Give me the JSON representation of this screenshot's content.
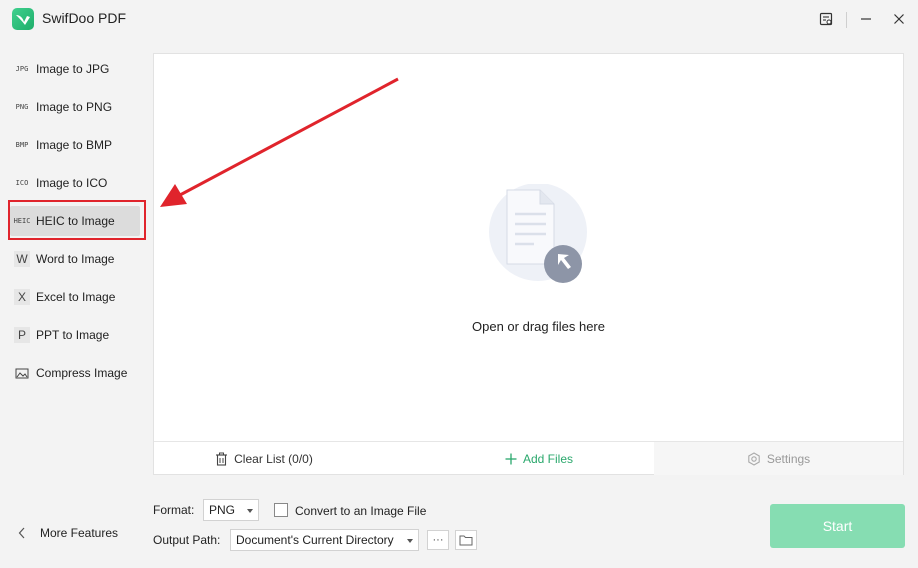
{
  "app": {
    "title": "SwifDoo PDF"
  },
  "sidebar": {
    "items": [
      {
        "icon_text": "JPG",
        "label": "Image to JPG"
      },
      {
        "icon_text": "PNG",
        "label": "Image to PNG"
      },
      {
        "icon_text": "BMP",
        "label": "Image to BMP"
      },
      {
        "icon_text": "ICO",
        "label": "Image to ICO"
      },
      {
        "icon_text": "HEIC",
        "label": "HEIC to Image",
        "active": true
      },
      {
        "icon_text": "W",
        "label": "Word to Image"
      },
      {
        "icon_text": "X",
        "label": "Excel to Image"
      },
      {
        "icon_text": "P",
        "label": "PPT to Image"
      },
      {
        "icon_text": "",
        "label": "Compress Image"
      }
    ],
    "more_features": "More Features"
  },
  "drop": {
    "text": "Open or drag files here"
  },
  "footer": {
    "clear_list": "Clear List (0/0)",
    "add_files": "Add Files",
    "settings": "Settings"
  },
  "options": {
    "format_label": "Format:",
    "format_value": "PNG",
    "convert_label": "Convert to an Image File",
    "output_label": "Output Path:",
    "output_value": "Document's Current Directory",
    "more_label": "···"
  },
  "start_label": "Start",
  "colors": {
    "accent": "#2aa86c",
    "start_disabled": "#86ddb2",
    "annotation": "#e0242c"
  }
}
